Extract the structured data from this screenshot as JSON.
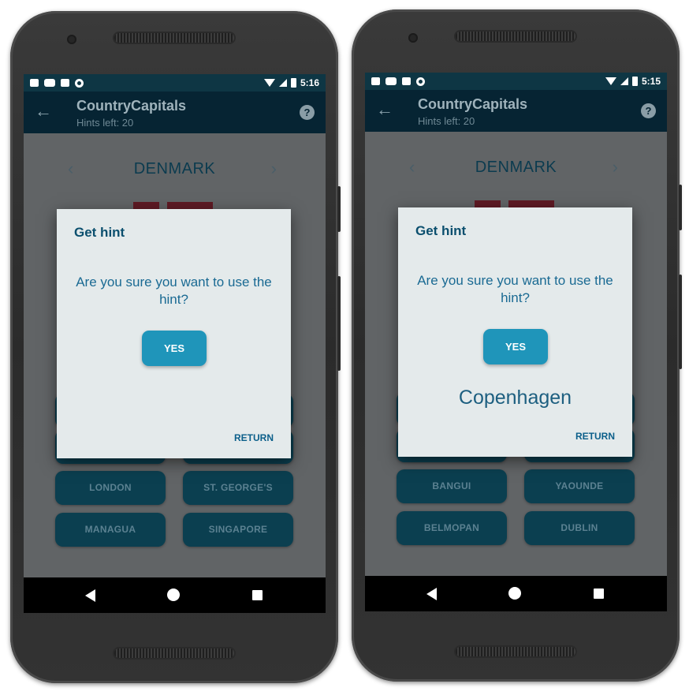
{
  "phones": [
    {
      "statusbar": {
        "time": "5:16"
      },
      "appbar": {
        "back_icon": "arrow-back-icon",
        "title": "CountryCapitals",
        "subtitle": "Hints left: 20",
        "help_icon": "help-icon"
      },
      "country": "DENMARK",
      "answers": [
        "LONDON",
        "ST. GEORGE'S",
        "MANAGUA",
        "SINGAPORE"
      ],
      "dialog": {
        "title": "Get hint",
        "message": "Are you sure you want to use the hint?",
        "yes": "YES",
        "hint_answer": "",
        "return": "RETURN"
      }
    },
    {
      "statusbar": {
        "time": "5:15"
      },
      "appbar": {
        "back_icon": "arrow-back-icon",
        "title": "CountryCapitals",
        "subtitle": "Hints left: 20",
        "help_icon": "help-icon"
      },
      "country": "DENMARK",
      "answers": [
        "BANGUI",
        "YAOUNDE",
        "BELMOPAN",
        "DUBLIN"
      ],
      "dialog": {
        "title": "Get hint",
        "message": "Are you sure you want to use the hint?",
        "yes": "YES",
        "hint_answer": "Copenhagen",
        "return": "RETURN"
      }
    }
  ],
  "colors": {
    "app_bar": "#062433",
    "status_bar": "#0e3644",
    "yes_button": "#1f95ba",
    "dialog_bg": "#e4eaeb",
    "answer_button": "#0b3f50"
  }
}
